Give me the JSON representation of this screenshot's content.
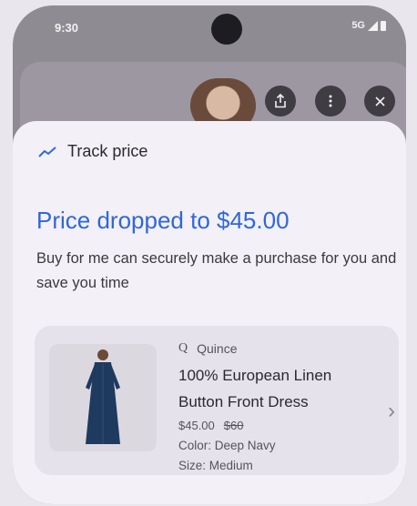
{
  "status_bar": {
    "time": "9:30",
    "network": "5G"
  },
  "top_actions": {
    "share_icon": "share-icon",
    "more_icon": "more-vert-icon",
    "close_icon": "close-icon"
  },
  "sheet": {
    "track_label": "Track price",
    "headline": "Price dropped to $45.00",
    "description": "Buy for me can securely make a purchase for you and save you time"
  },
  "product": {
    "merchant_icon": "Q",
    "merchant": "Quince",
    "name": "100% European Linen Button Front Dress",
    "price": "$45.00",
    "original_price": "$60",
    "color": "Color: Deep Navy",
    "size": "Size: Medium"
  },
  "colors": {
    "accent": "#2f68d6",
    "sheet_bg": "#f3f0f8",
    "card_bg": "#e6e2ec"
  }
}
